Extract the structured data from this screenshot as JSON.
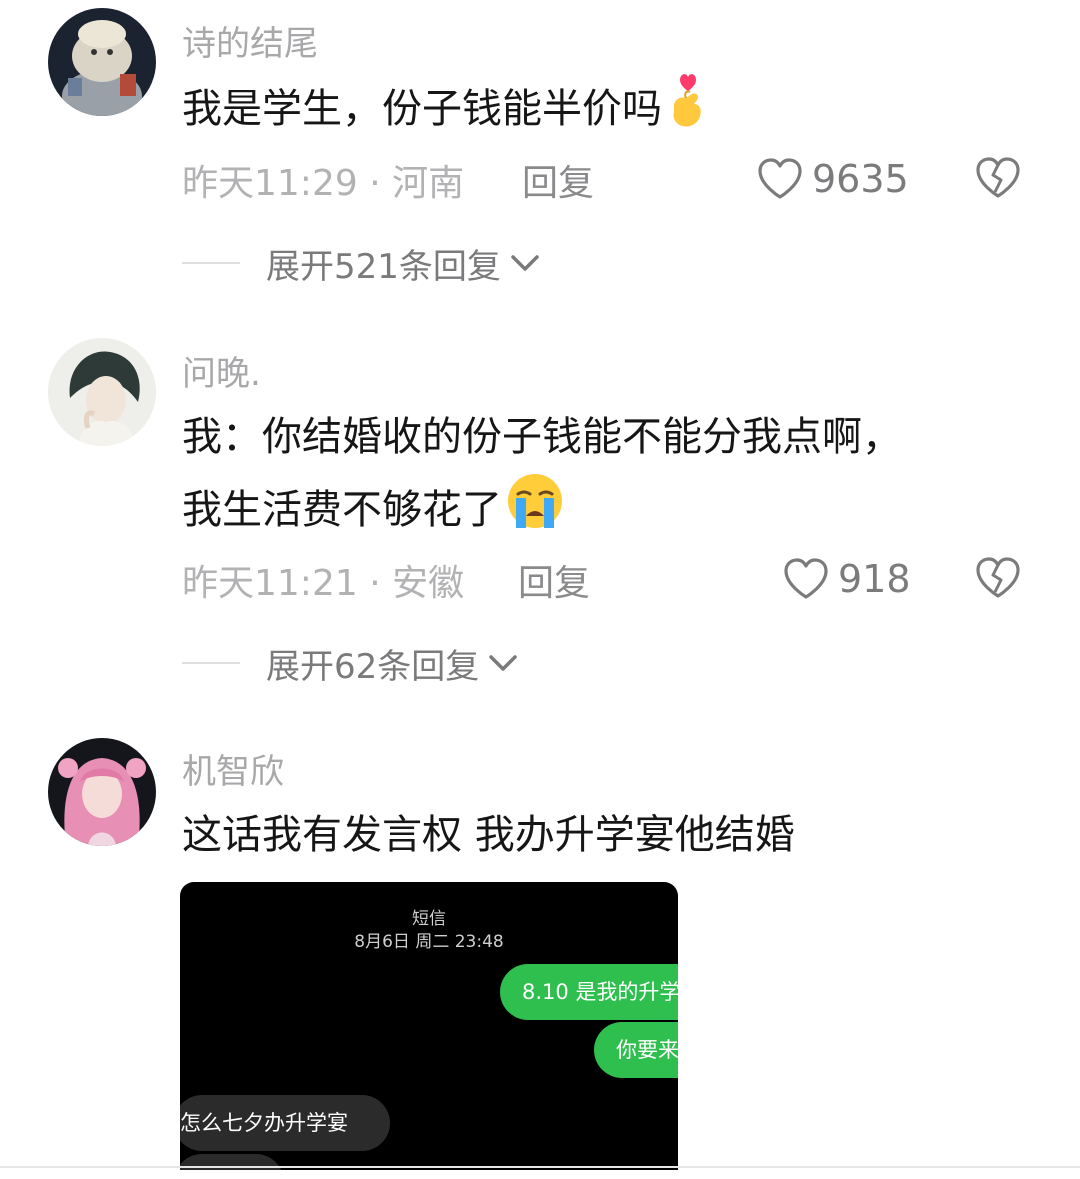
{
  "comments": [
    {
      "username": "诗的结尾",
      "text": "我是学生，份子钱能半价吗",
      "emoji": "finger-heart",
      "time_location": "昨天11:29 · 河南",
      "reply_label": "回复",
      "likes": "9635",
      "expand_label": "展开521条回复"
    },
    {
      "username": "问晚.",
      "text_line1": "我：你结婚收的份子钱能不能分我点啊，",
      "text_line2": "我生活费不够花了",
      "emoji": "loudly-crying-face",
      "time_location": "昨天11:21 · 安徽",
      "reply_label": "回复",
      "likes": "918",
      "expand_label": "展开62条回复"
    },
    {
      "username": "机智欣",
      "text": "这话我有发言权 我办升学宴他结婚",
      "attachment": {
        "title": "短信",
        "date": "8月6日 周二 23:48",
        "outgoing": [
          "8.10 是我的升学",
          "你要来"
        ],
        "incoming": [
          "怎么七夕办升学宴"
        ]
      }
    }
  ],
  "colors": {
    "username": "#a8a8aa",
    "body": "#161616",
    "meta": "#b2b2b4",
    "sms_green": "#2fbf4f"
  }
}
